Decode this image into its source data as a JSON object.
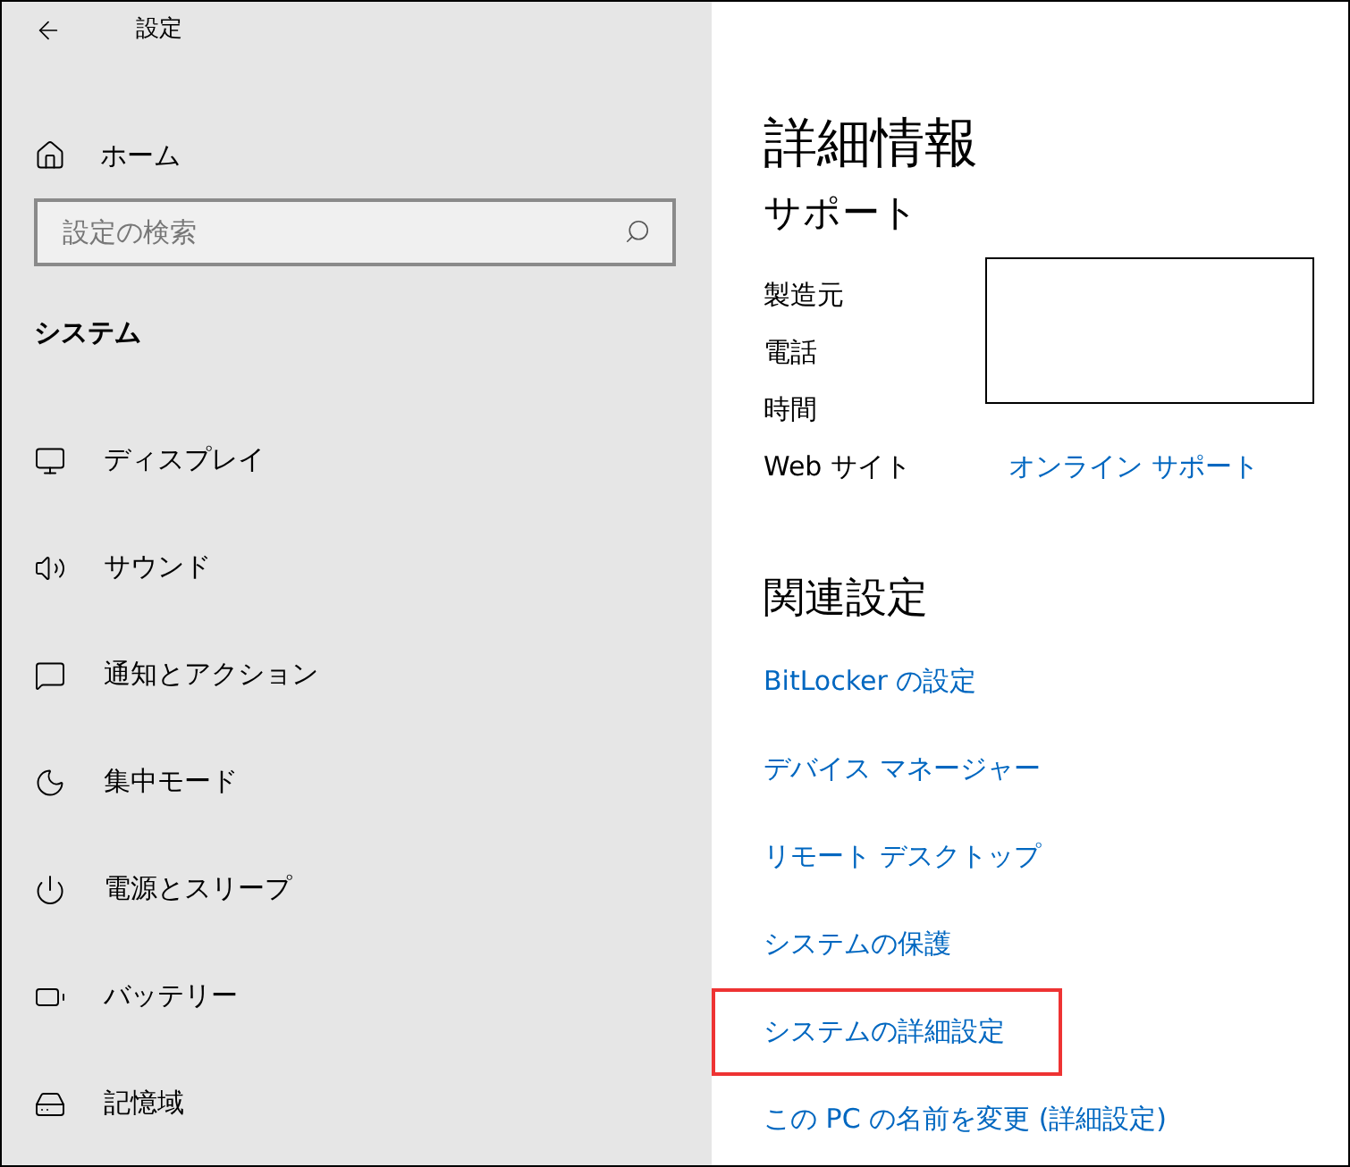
{
  "window": {
    "title": "設定"
  },
  "sidebar": {
    "home": "ホーム",
    "search": {
      "placeholder": "設定の検索"
    },
    "section": "システム",
    "items": [
      {
        "kind": "display",
        "label": "ディスプレイ"
      },
      {
        "kind": "sound",
        "label": "サウンド"
      },
      {
        "kind": "notifications",
        "label": "通知とアクション"
      },
      {
        "kind": "focus",
        "label": "集中モード"
      },
      {
        "kind": "power",
        "label": "電源とスリープ"
      },
      {
        "kind": "battery",
        "label": "バッテリー"
      },
      {
        "kind": "storage",
        "label": "記憶域"
      }
    ]
  },
  "main": {
    "title": "詳細情報",
    "support": {
      "heading": "サポート",
      "rows": [
        {
          "label": "製造元"
        },
        {
          "label": "電話"
        },
        {
          "label": "時間"
        },
        {
          "label": "Web サイト",
          "link": "オンライン サポート"
        }
      ],
      "redaction": true
    },
    "related": {
      "heading": "関連設定",
      "links": [
        {
          "label": "BitLocker の設定",
          "highlighted": false
        },
        {
          "label": "デバイス マネージャー",
          "highlighted": false
        },
        {
          "label": "リモート デスクトップ",
          "highlighted": false
        },
        {
          "label": "システムの保護",
          "highlighted": false
        },
        {
          "label": "システムの詳細設定",
          "highlighted": true
        },
        {
          "label": "この PC の名前を変更 (詳細設定)",
          "highlighted": false
        }
      ]
    }
  }
}
